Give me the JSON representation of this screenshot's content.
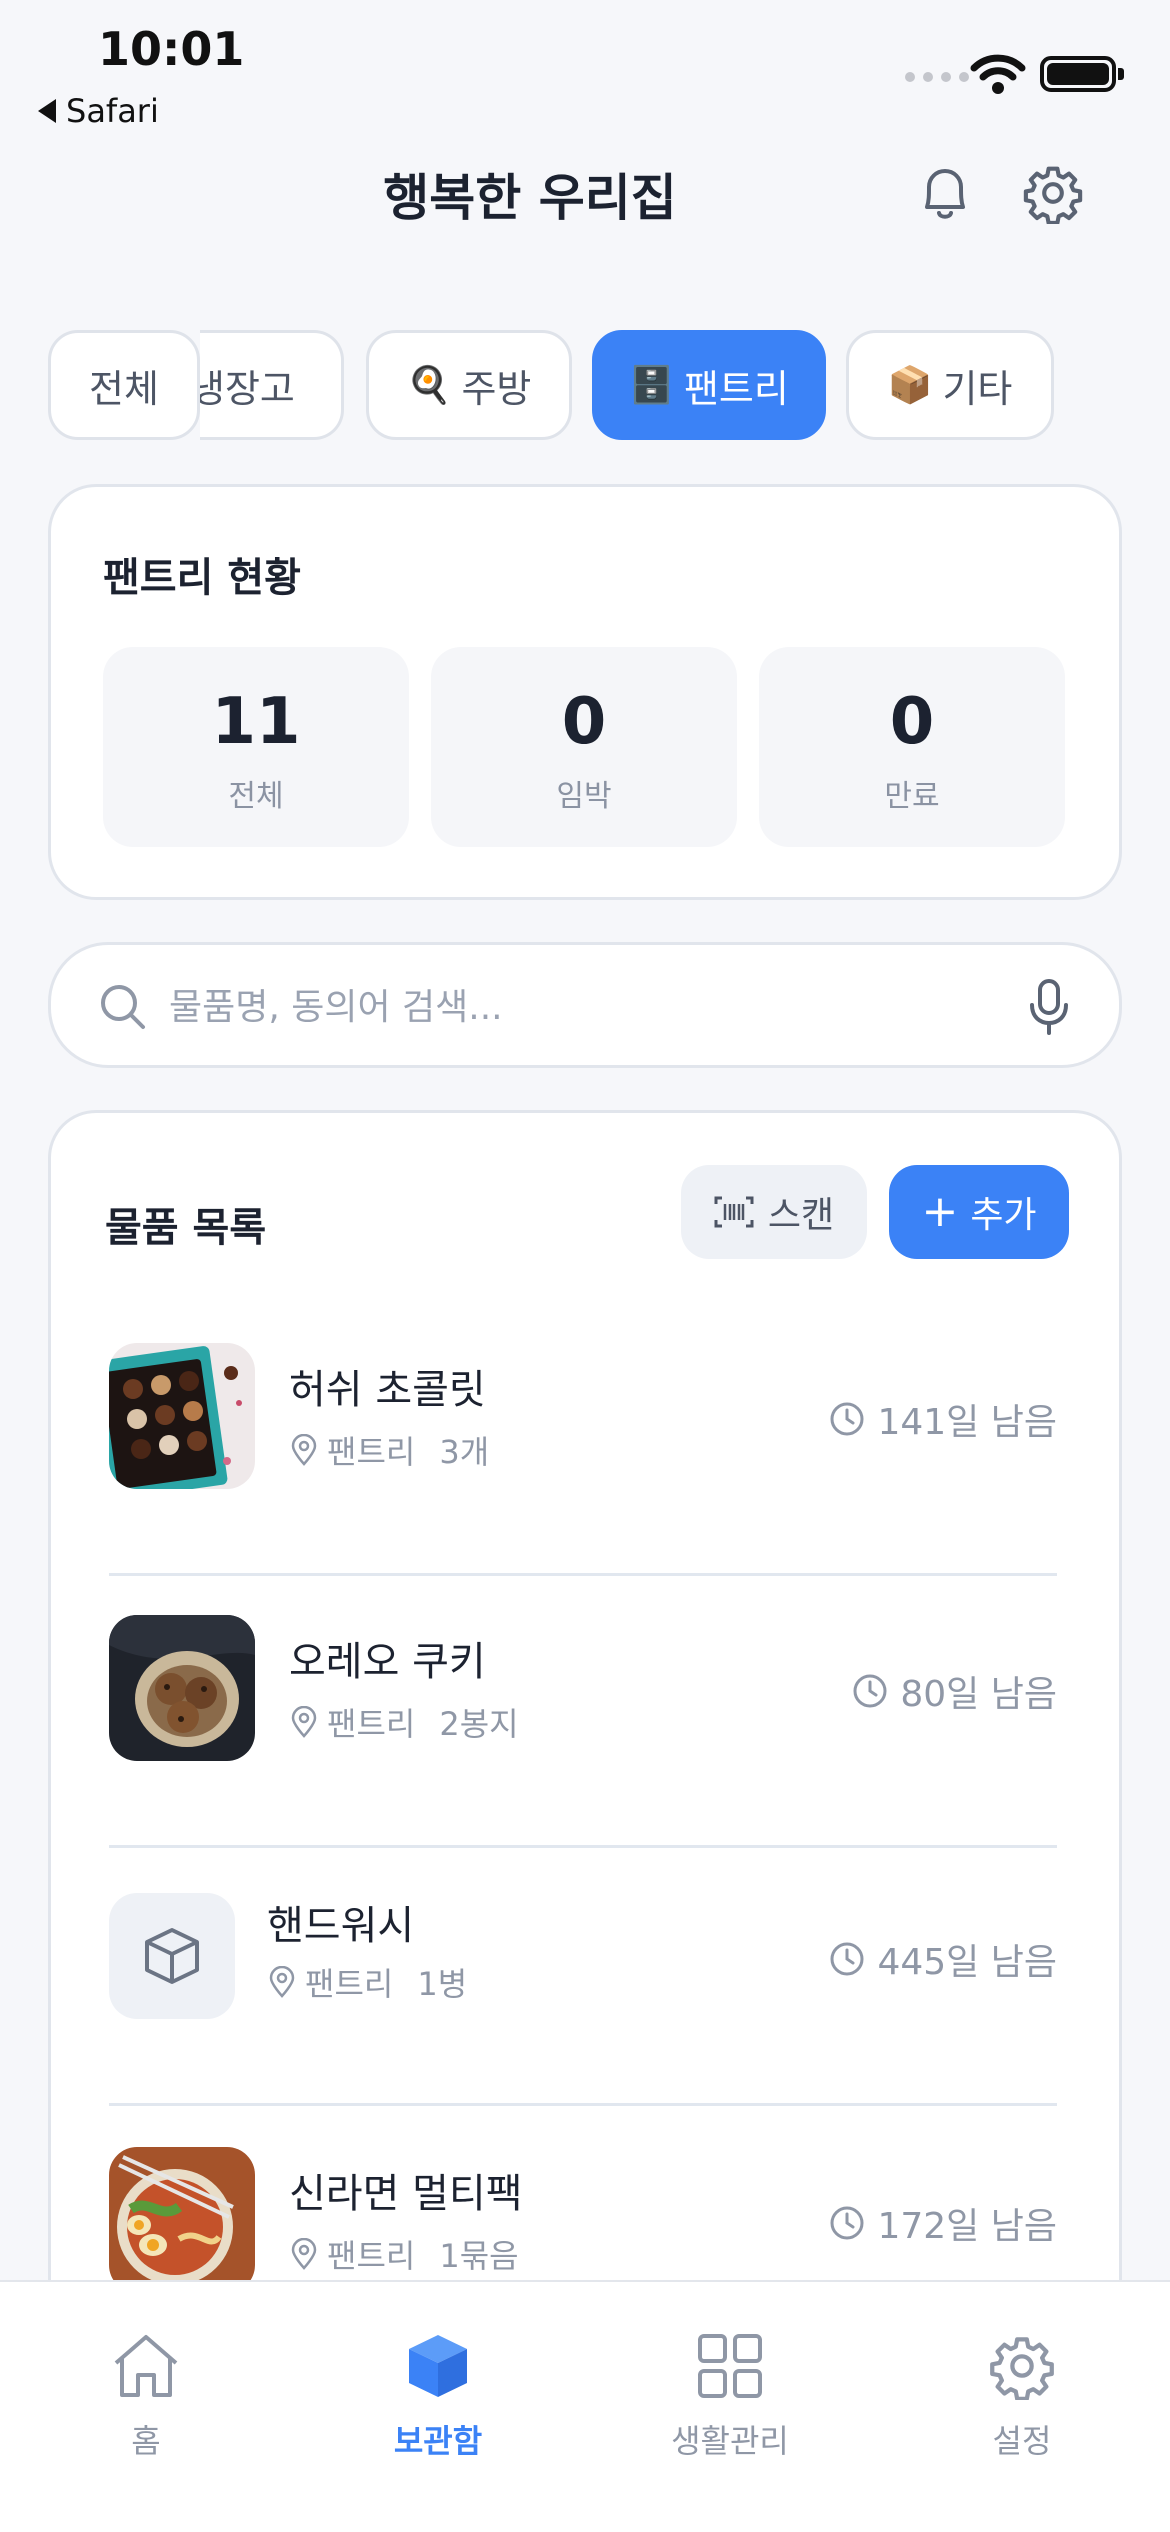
{
  "status_bar": {
    "time": "10:01",
    "back_label": "Safari"
  },
  "header": {
    "title": "행복한 우리집",
    "icons": [
      "bell-icon",
      "gear-icon"
    ]
  },
  "tabs": [
    {
      "label": "전체",
      "emoji": ""
    },
    {
      "label": "냉장고",
      "emoji": ""
    },
    {
      "label": "주방",
      "emoji": "🍳"
    },
    {
      "label": "팬트리",
      "emoji": "🗄️"
    },
    {
      "label": "기타",
      "emoji": "📦"
    }
  ],
  "active_tab": "팬트리",
  "summary": {
    "title": "팬트리 현황",
    "stats": [
      {
        "value": "11",
        "label": "전체"
      },
      {
        "value": "0",
        "label": "임박"
      },
      {
        "value": "0",
        "label": "만료"
      }
    ]
  },
  "search": {
    "placeholder": "물품명, 동의어 검색...",
    "value": ""
  },
  "list": {
    "title": "물품 목록",
    "scan_label": "스캔",
    "add_label": "추가",
    "items": [
      {
        "name": "허쉬 초콜릿",
        "location": "팬트리",
        "quantity": "3개",
        "due": "141일 남음",
        "thumb": "chocolate-box-photo"
      },
      {
        "name": "오레오 쿠키",
        "location": "팬트리",
        "quantity": "2봉지",
        "due": "80일 남음",
        "thumb": "cookies-photo"
      },
      {
        "name": "핸드워시",
        "location": "팬트리",
        "quantity": "1병",
        "due": "445일 남음",
        "thumb": "box-icon"
      },
      {
        "name": "신라면 멀티팩",
        "location": "팬트리",
        "quantity": "1묶음",
        "due": "172일 남음",
        "thumb": "ramen-bowl-photo"
      }
    ]
  },
  "bottom_nav": [
    {
      "label": "홈",
      "icon": "home-icon",
      "active": false
    },
    {
      "label": "보관함",
      "icon": "cube-icon",
      "active": true
    },
    {
      "label": "생활관리",
      "icon": "grid-icon",
      "active": false
    },
    {
      "label": "설정",
      "icon": "gear-icon",
      "active": false
    }
  ],
  "colors": {
    "accent": "#3b82f6",
    "background": "#f6f7fa",
    "muted_text": "#8f97a6"
  }
}
